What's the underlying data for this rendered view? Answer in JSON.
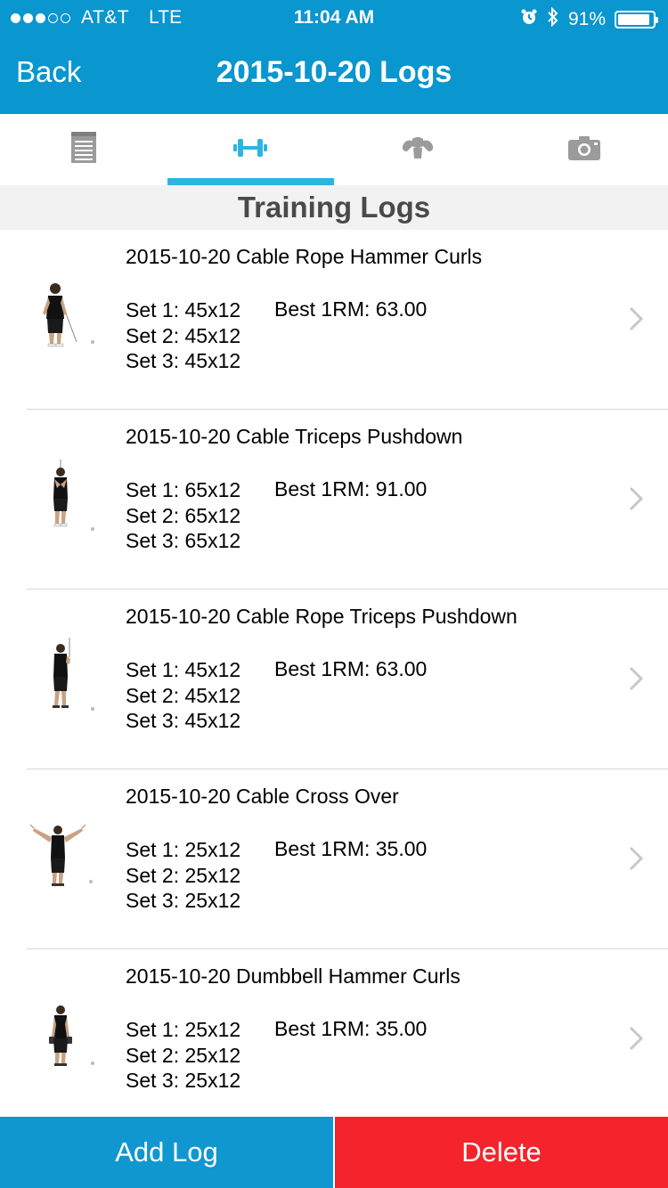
{
  "status_bar": {
    "carrier": "AT&T",
    "network": "LTE",
    "time": "11:04 AM",
    "battery": "91%",
    "signal_bars_filled": 3,
    "signal_bars_total": 5
  },
  "nav": {
    "back_label": "Back",
    "title": "2015-10-20 Logs"
  },
  "tabs": [
    {
      "icon": "notepad-icon",
      "active": false
    },
    {
      "icon": "dumbbell-icon",
      "active": true
    },
    {
      "icon": "muscle-icon",
      "active": false
    },
    {
      "icon": "camera-icon",
      "active": false
    }
  ],
  "section": {
    "title": "Training Logs"
  },
  "logs": [
    {
      "title": "2015-10-20 Cable Rope Hammer Curls",
      "set1": "Set 1: 45x12",
      "set2": "Set 2: 45x12",
      "set3": "Set 3: 45x12",
      "best": "Best 1RM: 63.00"
    },
    {
      "title": "2015-10-20 Cable Triceps Pushdown",
      "set1": "Set 1: 65x12",
      "set2": "Set 2: 65x12",
      "set3": "Set 3: 65x12",
      "best": "Best 1RM: 91.00"
    },
    {
      "title": "2015-10-20 Cable Rope Triceps Pushdown",
      "set1": "Set 1: 45x12",
      "set2": "Set 2: 45x12",
      "set3": "Set 3: 45x12",
      "best": "Best 1RM: 63.00"
    },
    {
      "title": "2015-10-20 Cable Cross Over",
      "set1": "Set 1: 25x12",
      "set2": "Set 2: 25x12",
      "set3": "Set 3: 25x12",
      "best": "Best 1RM: 35.00"
    },
    {
      "title": "2015-10-20 Dumbbell Hammer Curls",
      "set1": "Set 1: 25x12",
      "set2": "Set 2: 25x12",
      "set3": "Set 3: 25x12",
      "best": "Best 1RM: 35.00"
    }
  ],
  "buttons": {
    "add_label": "Add Log",
    "delete_label": "Delete"
  },
  "colors": {
    "nav_blue": "#0a96cf",
    "tab_indicator": "#2eb4e3",
    "active_tab_icon": "#2eb4e3",
    "inactive_tab_icon": "#9b9b9b",
    "add_button": "#1097d0",
    "delete_button": "#f5232b"
  }
}
